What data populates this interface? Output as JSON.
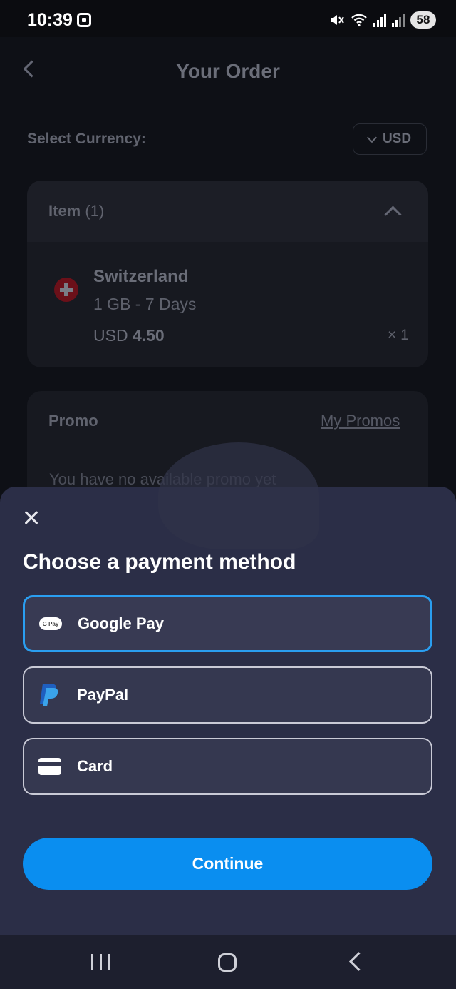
{
  "status_bar": {
    "time": "10:39",
    "battery": "58",
    "icons": [
      "screenshot-icon",
      "mute-icon",
      "wifi-icon",
      "signal-icon",
      "signal-r-icon",
      "battery-icon"
    ]
  },
  "header": {
    "title": "Your Order",
    "back_icon": "chevron-left-icon"
  },
  "currency": {
    "label": "Select Currency:",
    "value": "USD"
  },
  "items_card": {
    "label": "Item",
    "count": "(1)",
    "item": {
      "country": "Switzerland",
      "plan": "1 GB - 7 Days",
      "currency": "USD",
      "price": "4.50",
      "quantity": "× 1"
    }
  },
  "promo_card": {
    "label": "Promo",
    "link": "My Promos",
    "empty_text": "You have no available promo yet"
  },
  "payment_sheet": {
    "title": "Choose a payment method",
    "options": [
      {
        "label": "Google Pay",
        "icon": "google-pay-icon",
        "icon_text": "G Pay",
        "selected": true
      },
      {
        "label": "PayPal",
        "icon": "paypal-icon",
        "selected": false
      },
      {
        "label": "Card",
        "icon": "card-icon",
        "selected": false
      }
    ],
    "continue_label": "Continue"
  },
  "colors": {
    "accent": "#0a8ef0",
    "sheet_bg": "#2b2e47",
    "selected_border": "#2a9ef0",
    "page_bg": "#0e1016"
  }
}
